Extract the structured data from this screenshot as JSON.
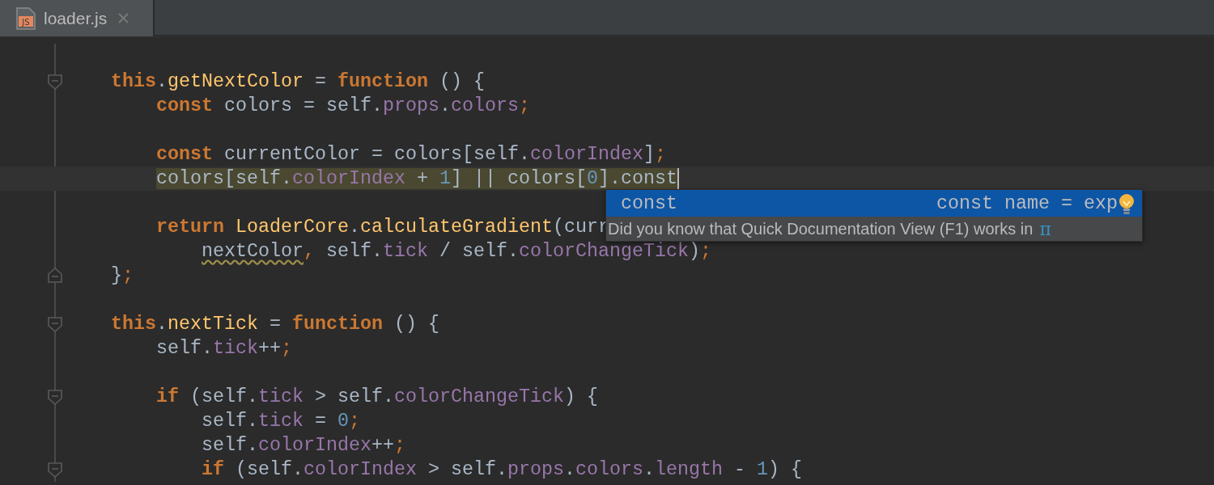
{
  "tabs": [
    {
      "label": "loader.js",
      "icon": "JS",
      "selected": true
    }
  ],
  "code": [
    {
      "kind": "code",
      "fold_open": true,
      "tokens": [
        {
          "kind": "kw",
          "text": "this"
        },
        {
          "kind": "plain",
          "text": "."
        },
        {
          "kind": "fn",
          "text": "getNextColor"
        },
        {
          "kind": "plain",
          "text": " = "
        },
        {
          "kind": "kw",
          "text": "function"
        },
        {
          "kind": "plain",
          "text": " () {"
        }
      ],
      "children": [
        {
          "kind": "code",
          "tokens": [
            {
              "kind": "kw",
              "text": "const"
            },
            {
              "kind": "plain",
              "text": " colors = self."
            },
            {
              "kind": "prop",
              "text": "props"
            },
            {
              "kind": "plain",
              "text": "."
            },
            {
              "kind": "prop",
              "text": "colors"
            },
            {
              "kind": "punc",
              "text": ";"
            }
          ]
        },
        {
          "kind": "blank"
        },
        {
          "kind": "code",
          "tokens": [
            {
              "kind": "kw",
              "text": "const"
            },
            {
              "kind": "plain",
              "text": " currentColor = colors[self."
            },
            {
              "kind": "prop",
              "text": "colorIndex"
            },
            {
              "kind": "plain",
              "text": "]"
            },
            {
              "kind": "punc",
              "text": ";"
            }
          ]
        },
        {
          "kind": "code",
          "current": true,
          "marked": true,
          "tokens": [
            {
              "kind": "plain",
              "text": "colors[self."
            },
            {
              "kind": "prop",
              "text": "colorIndex"
            },
            {
              "kind": "plain",
              "text": " + "
            },
            {
              "kind": "num",
              "text": "1"
            },
            {
              "kind": "plain",
              "text": "] || colors["
            },
            {
              "kind": "num",
              "text": "0"
            },
            {
              "kind": "plain",
              "text": "].const"
            }
          ]
        },
        {
          "kind": "blank"
        },
        {
          "kind": "code",
          "tokens": [
            {
              "kind": "kw",
              "text": "return "
            },
            {
              "kind": "fn",
              "text": "LoaderCore"
            },
            {
              "kind": "plain",
              "text": "."
            },
            {
              "kind": "fn",
              "text": "calculateGradient"
            },
            {
              "kind": "plain",
              "text": "(curr"
            }
          ],
          "children": [
            {
              "kind": "code",
              "tokens": [
                {
                  "kind": "plain",
                  "text": "nextColor",
                  "warning": true
                },
                {
                  "kind": "punc",
                  "text": ","
                },
                {
                  "kind": "plain",
                  "text": " self."
                },
                {
                  "kind": "prop",
                  "text": "tick"
                },
                {
                  "kind": "plain",
                  "text": " / self."
                },
                {
                  "kind": "prop",
                  "text": "colorChangeTick"
                },
                {
                  "kind": "plain",
                  "text": ")"
                },
                {
                  "kind": "punc",
                  "text": ";"
                }
              ]
            }
          ]
        }
      ]
    },
    {
      "kind": "code",
      "fold_close": true,
      "tokens": [
        {
          "kind": "plain",
          "text": "}"
        },
        {
          "kind": "punc",
          "text": ";"
        }
      ]
    },
    {
      "kind": "blank"
    },
    {
      "kind": "code",
      "fold_open": true,
      "tokens": [
        {
          "kind": "kw",
          "text": "this"
        },
        {
          "kind": "plain",
          "text": "."
        },
        {
          "kind": "fn",
          "text": "nextTick"
        },
        {
          "kind": "plain",
          "text": " = "
        },
        {
          "kind": "kw",
          "text": "function"
        },
        {
          "kind": "plain",
          "text": " () {"
        }
      ],
      "children": [
        {
          "kind": "code",
          "tokens": [
            {
              "kind": "plain",
              "text": "self."
            },
            {
              "kind": "prop",
              "text": "tick"
            },
            {
              "kind": "plain",
              "text": "++"
            },
            {
              "kind": "punc",
              "text": ";"
            }
          ]
        },
        {
          "kind": "blank"
        },
        {
          "kind": "code",
          "fold_open": true,
          "tokens": [
            {
              "kind": "kw",
              "text": "if"
            },
            {
              "kind": "plain",
              "text": " (self."
            },
            {
              "kind": "prop",
              "text": "tick"
            },
            {
              "kind": "plain",
              "text": " > self."
            },
            {
              "kind": "prop",
              "text": "colorChangeTick"
            },
            {
              "kind": "plain",
              "text": ") {"
            }
          ],
          "children": [
            {
              "kind": "code",
              "tokens": [
                {
                  "kind": "plain",
                  "text": "self."
                },
                {
                  "kind": "prop",
                  "text": "tick"
                },
                {
                  "kind": "plain",
                  "text": " = "
                },
                {
                  "kind": "num",
                  "text": "0"
                },
                {
                  "kind": "punc",
                  "text": ";"
                }
              ]
            },
            {
              "kind": "code",
              "tokens": [
                {
                  "kind": "plain",
                  "text": "self."
                },
                {
                  "kind": "prop",
                  "text": "colorIndex"
                },
                {
                  "kind": "plain",
                  "text": "++"
                },
                {
                  "kind": "punc",
                  "text": ";"
                }
              ]
            },
            {
              "kind": "code",
              "fold_open": true,
              "tokens": [
                {
                  "kind": "kw",
                  "text": "if"
                },
                {
                  "kind": "plain",
                  "text": " (self."
                },
                {
                  "kind": "prop",
                  "text": "colorIndex"
                },
                {
                  "kind": "plain",
                  "text": " > self."
                },
                {
                  "kind": "prop",
                  "text": "props"
                },
                {
                  "kind": "plain",
                  "text": "."
                },
                {
                  "kind": "prop",
                  "text": "colors"
                },
                {
                  "kind": "plain",
                  "text": "."
                },
                {
                  "kind": "prop",
                  "text": "length"
                },
                {
                  "kind": "plain",
                  "text": " - "
                },
                {
                  "kind": "num",
                  "text": "1"
                },
                {
                  "kind": "plain",
                  "text": ") {"
                }
              ]
            }
          ]
        }
      ]
    }
  ],
  "completion": {
    "items": [
      {
        "label": "const",
        "detail": "const name = exp",
        "selected": true
      }
    ],
    "hint": {
      "text": "Did you know that Quick Documentation View (F1) works in",
      "symbol": "π"
    }
  }
}
